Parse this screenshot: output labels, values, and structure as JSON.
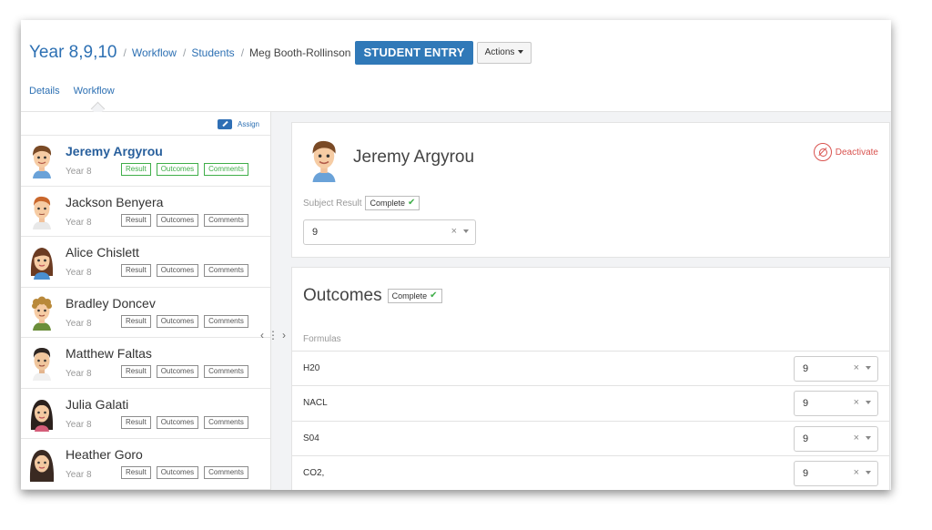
{
  "breadcrumb": {
    "title": "Year 8,9,10",
    "workflow": "Workflow",
    "students": "Students",
    "current": "Meg Booth-Rollinson"
  },
  "header": {
    "student_entry": "STUDENT ENTRY",
    "actions": "Actions"
  },
  "tabs": [
    {
      "label": "Details"
    },
    {
      "label": "Workflow",
      "active": true
    }
  ],
  "sidebar": {
    "assign_label": "Assign",
    "tag_labels": [
      "Result",
      "Outcomes",
      "Comments"
    ],
    "students": [
      {
        "name": "Jeremy Argyrou",
        "year": "Year 8",
        "active": true,
        "avatar": "boy-brown-hair"
      },
      {
        "name": "Jackson Benyera",
        "year": "Year 8",
        "avatar": "boy-ginger-hair"
      },
      {
        "name": "Alice Chislett",
        "year": "Year 8",
        "avatar": "girl-brown-hair"
      },
      {
        "name": "Bradley Doncev",
        "year": "Year 8",
        "avatar": "boy-curly-hair"
      },
      {
        "name": "Matthew Faltas",
        "year": "Year 8",
        "avatar": "boy-dark-hair"
      },
      {
        "name": "Julia Galati",
        "year": "Year 8",
        "avatar": "girl-dark-hair"
      },
      {
        "name": "Heather Goro",
        "year": "Year 8",
        "avatar": "girl-long-hair"
      }
    ]
  },
  "detail": {
    "name": "Jeremy Argyrou",
    "deactivate": "Deactivate",
    "subject_result_label": "Subject Result",
    "complete_label": "Complete",
    "result_value": "9"
  },
  "outcomes": {
    "title": "Outcomes",
    "complete_label": "Complete",
    "formulas_label": "Formulas",
    "rows": [
      {
        "name": "H20",
        "value": "9"
      },
      {
        "name": "NACL",
        "value": "9"
      },
      {
        "name": "S04",
        "value": "9"
      },
      {
        "name": "CO2,",
        "value": "9"
      }
    ]
  },
  "icons": {
    "assign": "pencil-icon",
    "deactivate": "ban-icon",
    "complete": "check-icon",
    "clear": "clear-icon",
    "dropdown": "chevron-down-icon",
    "splitter": "resize-handle-icon"
  },
  "colors": {
    "primary": "#3079b8",
    "link": "#2d70b3",
    "success": "#3fae49",
    "danger": "#d9534f"
  }
}
